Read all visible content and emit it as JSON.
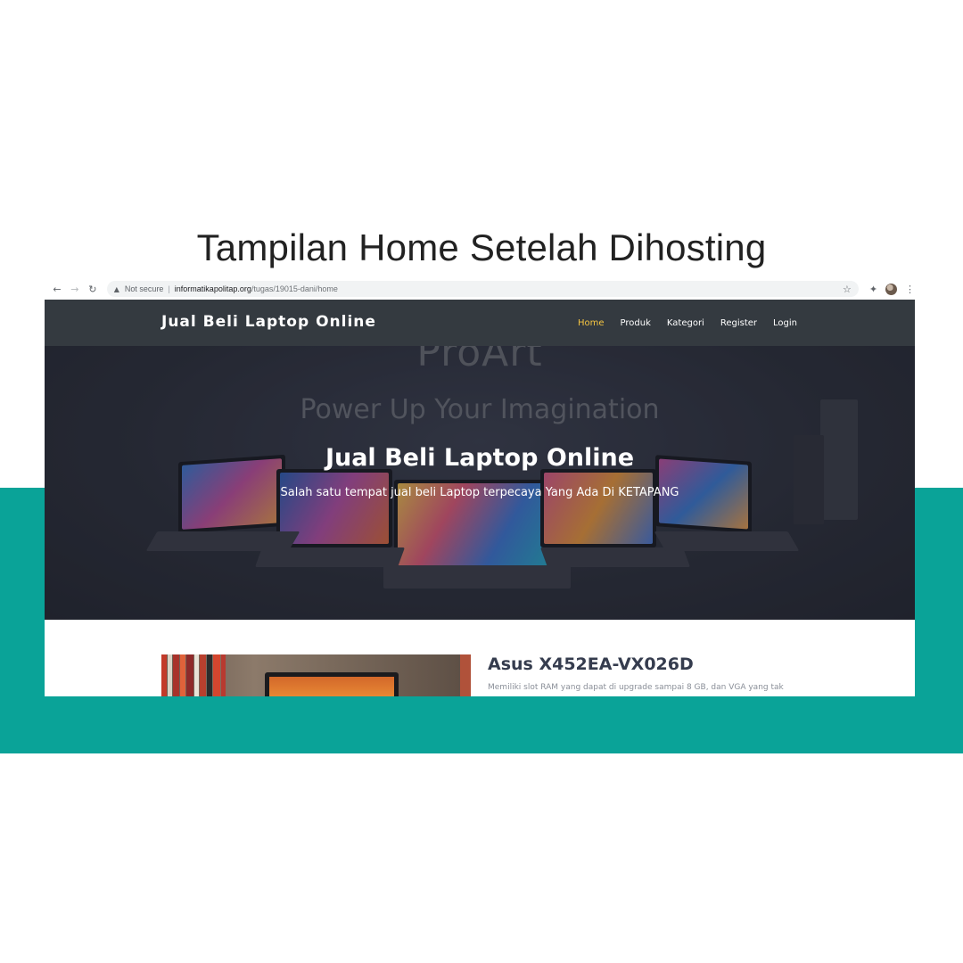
{
  "slide": {
    "title": "Tampilan Home Setelah Dihosting"
  },
  "browser": {
    "back_icon": "arrow-left-icon",
    "forward_icon": "arrow-right-icon",
    "reload_icon": "reload-icon",
    "security_label": "Not secure",
    "url_host": "informatikapolitap.org",
    "url_path": "/tugas/19015-dani/home"
  },
  "site": {
    "brand": "Jual Beli Laptop Online",
    "nav": [
      {
        "label": "Home",
        "active": true
      },
      {
        "label": "Produk"
      },
      {
        "label": "Kategori"
      },
      {
        "label": "Register"
      },
      {
        "label": "Login"
      }
    ],
    "hero": {
      "background_logo": "ProArt",
      "background_tagline": "Power Up Your Imagination",
      "title": "Jual Beli Laptop Online",
      "subtitle": "Salah satu tempat jual beli Laptop terpecaya Yang Ada Di KETAPANG"
    },
    "product": {
      "title": "Asus X452EA-VX026D",
      "description": "Memiliki slot RAM yang dapat di upgrade sampai 8 GB, dan VGA yang tak"
    }
  },
  "colors": {
    "teal_band": "#0aa398",
    "navbar": "#343a40",
    "nav_active": "#f5c542"
  }
}
